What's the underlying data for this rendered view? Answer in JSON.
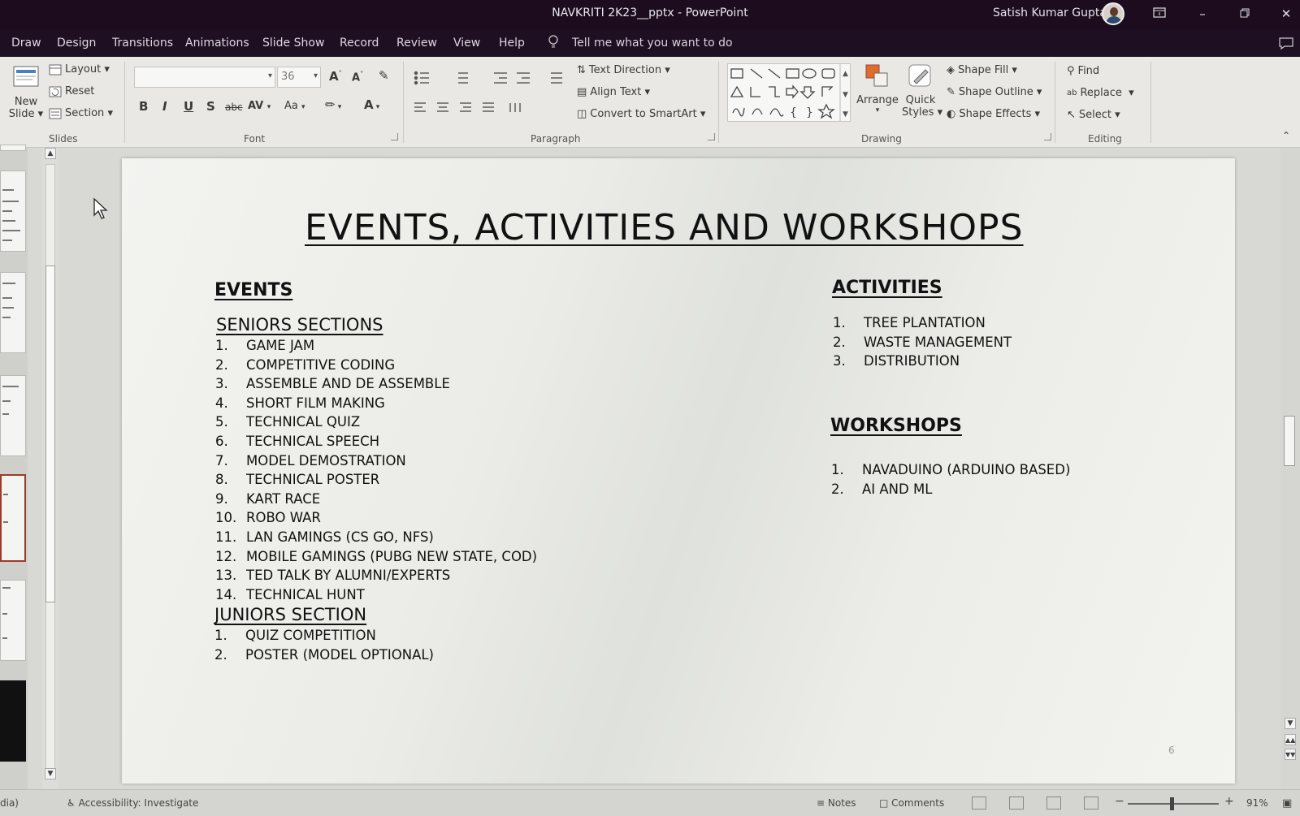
{
  "titlebar": {
    "title": "NAVKRITI 2K23__pptx  -  PowerPoint",
    "user": "Satish Kumar Gupta",
    "controls": [
      "ribbon-display-icon",
      "minimize-icon",
      "restore-icon",
      "close-icon"
    ]
  },
  "menu": {
    "tabs": [
      "Draw",
      "Design",
      "Transitions",
      "Animations",
      "Slide Show",
      "Record",
      "Review",
      "View",
      "Help"
    ],
    "tell_me": "Tell me what you want to do"
  },
  "ribbon": {
    "slides": {
      "new_slide": "New",
      "new_slide2": "Slide",
      "layout": "Layout",
      "reset": "Reset",
      "section": "Section",
      "label": "Slides"
    },
    "font": {
      "family": "",
      "size": "36",
      "bold": "B",
      "italic": "I",
      "underline": "U",
      "shadow": "S",
      "strike": "abc",
      "spacing": "AV",
      "case": "Aa",
      "color": "A",
      "grow": "A",
      "shrink": "A",
      "label": "Font"
    },
    "paragraph": {
      "text_direction": "Text Direction",
      "align_text": "Align Text",
      "smartart": "Convert to SmartArt",
      "label": "Paragraph"
    },
    "drawing": {
      "arrange": "Arrange",
      "quick": "Quick",
      "styles": "Styles",
      "shape_fill": "Shape Fill",
      "shape_outline": "Shape Outline",
      "shape_effects": "Shape Effects",
      "label": "Drawing"
    },
    "editing": {
      "find": "Find",
      "replace": "Replace",
      "select": "Select",
      "label": "Editing"
    }
  },
  "slide": {
    "title": "EVENTS, ACTIVITIES AND WORKSHOPS",
    "events": {
      "heading": "EVENTS",
      "seniors": {
        "heading": "SENIORS SECTIONS",
        "items": [
          {
            "n": "1.",
            "text": "GAME JAM"
          },
          {
            "n": "2.",
            "text": "COMPETITIVE CODING"
          },
          {
            "n": "3.",
            "text": "ASSEMBLE AND DE ASSEMBLE"
          },
          {
            "n": "4.",
            "text": "SHORT FILM MAKING"
          },
          {
            "n": "5.",
            "text": "TECHNICAL QUIZ"
          },
          {
            "n": "6.",
            "text": "TECHNICAL SPEECH"
          },
          {
            "n": "7.",
            "text": "MODEL DEMOSTRATION"
          },
          {
            "n": "8.",
            "text": "TECHNICAL POSTER"
          },
          {
            "n": "9.",
            "text": "KART RACE"
          },
          {
            "n": "10.",
            "text": "ROBO WAR"
          },
          {
            "n": "11.",
            "text": "LAN GAMINGS (CS GO, NFS)"
          },
          {
            "n": "12.",
            "text": "MOBILE GAMINGS (PUBG NEW STATE, COD)"
          },
          {
            "n": "13.",
            "text": "TED TALK BY ALUMNI/EXPERTS"
          },
          {
            "n": "14.",
            "text": "TECHNICAL HUNT"
          }
        ]
      },
      "juniors": {
        "heading": "JUNIORS SECTION",
        "items": [
          {
            "n": "1.",
            "text": "QUIZ COMPETITION"
          },
          {
            "n": "2.",
            "text": "POSTER (MODEL OPTIONAL)"
          }
        ]
      }
    },
    "activities": {
      "heading": "ACTIVITIES",
      "items": [
        {
          "n": "1.",
          "text": "TREE PLANTATION"
        },
        {
          "n": "2.",
          "text": "WASTE MANAGEMENT"
        },
        {
          "n": "3.",
          "text": "DISTRIBUTION"
        }
      ]
    },
    "workshops": {
      "heading": "WORKSHOPS",
      "items": [
        {
          "n": "1.",
          "text": "NAVADUINO (ARDUINO BASED)"
        },
        {
          "n": "2.",
          "text": "AI AND ML"
        }
      ]
    },
    "number": "6"
  },
  "status": {
    "left": "dia)",
    "accessibility": "Accessibility: Investigate",
    "notes": "Notes",
    "comments": "Comments",
    "zoom": "91%"
  }
}
